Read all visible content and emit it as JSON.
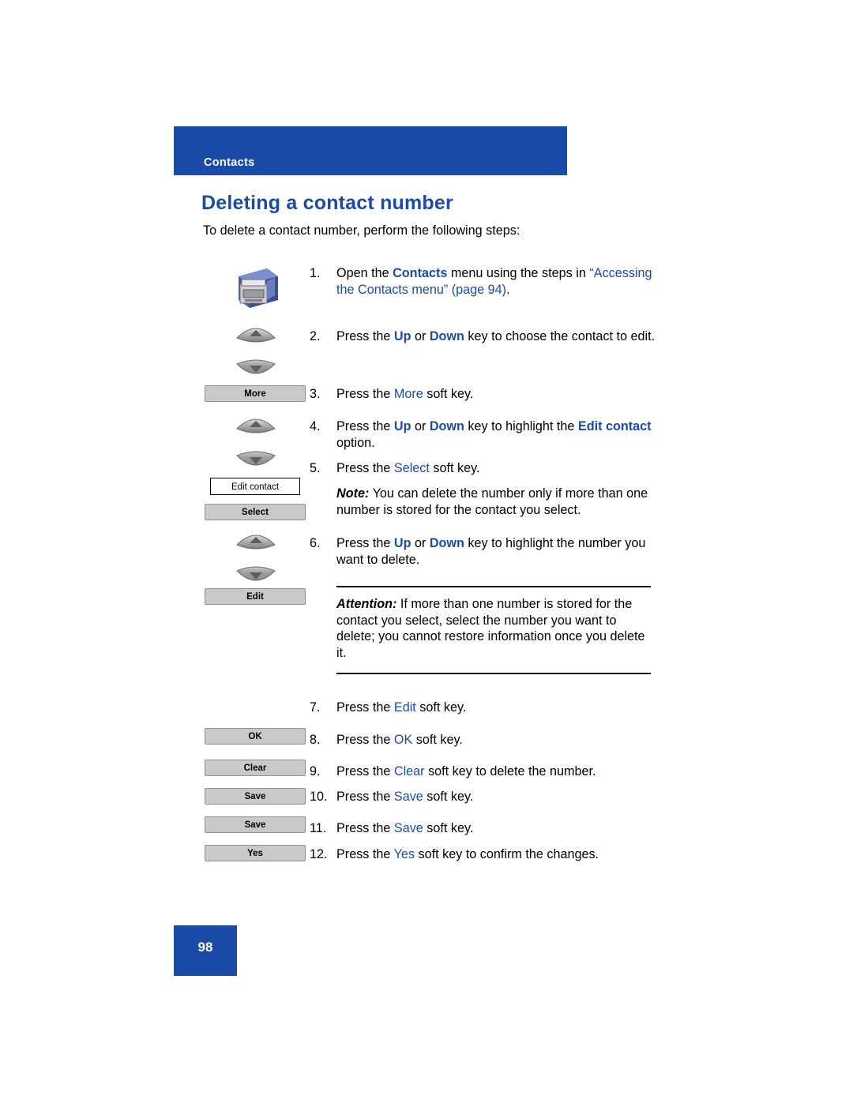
{
  "header": {
    "label": "Contacts",
    "bar_color": "#1b4ba8"
  },
  "title": "Deleting a contact number",
  "intro": "To delete a contact number, perform the following steps:",
  "steps": [
    {
      "num": "1.",
      "parts": [
        {
          "t": "Open the ",
          "s": "plain"
        },
        {
          "t": "Contacts",
          "s": "bold-blue"
        },
        {
          "t": " menu using the steps in ",
          "s": "plain"
        },
        {
          "t": "“Accessing the Contacts menu” (page 94)",
          "s": "blue"
        },
        {
          "t": ".",
          "s": "plain"
        }
      ]
    },
    {
      "num": "2.",
      "parts": [
        {
          "t": "Press the ",
          "s": "plain"
        },
        {
          "t": "Up",
          "s": "bold-blue"
        },
        {
          "t": " or ",
          "s": "plain"
        },
        {
          "t": "Down",
          "s": "bold-blue"
        },
        {
          "t": " key to choose the contact to edit.",
          "s": "plain"
        }
      ]
    },
    {
      "num": "3.",
      "parts": [
        {
          "t": "Press the ",
          "s": "plain"
        },
        {
          "t": "More",
          "s": "blue"
        },
        {
          "t": " soft key.",
          "s": "plain"
        }
      ]
    },
    {
      "num": "4.",
      "parts": [
        {
          "t": "Press the ",
          "s": "plain"
        },
        {
          "t": "Up",
          "s": "bold-blue"
        },
        {
          "t": " or ",
          "s": "plain"
        },
        {
          "t": "Down",
          "s": "bold-blue"
        },
        {
          "t": " key to highlight the ",
          "s": "plain"
        },
        {
          "t": "Edit contact",
          "s": "bold-blue"
        },
        {
          "t": " option.",
          "s": "plain"
        }
      ]
    },
    {
      "num": "5.",
      "parts": [
        {
          "t": "Press the ",
          "s": "plain"
        },
        {
          "t": "Select",
          "s": "blue"
        },
        {
          "t": " soft key.",
          "s": "plain"
        }
      ]
    },
    {
      "num": "6.",
      "parts": [
        {
          "t": "Press the ",
          "s": "plain"
        },
        {
          "t": "Up",
          "s": "bold-blue"
        },
        {
          "t": " or ",
          "s": "plain"
        },
        {
          "t": "Down",
          "s": "bold-blue"
        },
        {
          "t": " key to highlight the number you want to delete.",
          "s": "plain"
        }
      ]
    },
    {
      "num": "7.",
      "parts": [
        {
          "t": "Press the ",
          "s": "plain"
        },
        {
          "t": "Edit",
          "s": "blue"
        },
        {
          "t": " soft key.",
          "s": "plain"
        }
      ]
    },
    {
      "num": "8.",
      "parts": [
        {
          "t": "Press the ",
          "s": "plain"
        },
        {
          "t": "OK",
          "s": "blue"
        },
        {
          "t": " soft key.",
          "s": "plain"
        }
      ]
    },
    {
      "num": "9.",
      "parts": [
        {
          "t": "Press the ",
          "s": "plain"
        },
        {
          "t": "Clear",
          "s": "blue"
        },
        {
          "t": " soft key to delete the number.",
          "s": "plain"
        }
      ]
    },
    {
      "num": "10.",
      "parts": [
        {
          "t": "Press the ",
          "s": "plain"
        },
        {
          "t": "Save",
          "s": "blue"
        },
        {
          "t": " soft key.",
          "s": "plain"
        }
      ]
    },
    {
      "num": "11.",
      "parts": [
        {
          "t": "Press the ",
          "s": "plain"
        },
        {
          "t": "Save",
          "s": "blue"
        },
        {
          "t": " soft key.",
          "s": "plain"
        }
      ]
    },
    {
      "num": "12.",
      "parts": [
        {
          "t": "Press the ",
          "s": "plain"
        },
        {
          "t": "Yes",
          "s": "blue"
        },
        {
          "t": " soft key to confirm the changes.",
          "s": "plain"
        }
      ]
    }
  ],
  "note": {
    "lead": "Note:",
    "text": " You can delete the number only if more than one number is stored for the contact you select."
  },
  "attention": {
    "lead": "Attention:",
    "text": " If more than one number is stored for the contact you select, select the number you want to delete; you cannot restore information once you delete it."
  },
  "graphics": {
    "softkeys": [
      {
        "label": "More"
      },
      {
        "label": "Select"
      },
      {
        "label": "Edit"
      },
      {
        "label": "OK"
      },
      {
        "label": "Clear"
      },
      {
        "label": "Save"
      },
      {
        "label": "Save"
      },
      {
        "label": "Yes"
      }
    ],
    "labelbox": "Edit contact",
    "icons": [
      "contacts-directory-icon",
      "nav-up-key-icon",
      "nav-down-key-icon"
    ]
  },
  "footer": {
    "page_number": "98"
  }
}
